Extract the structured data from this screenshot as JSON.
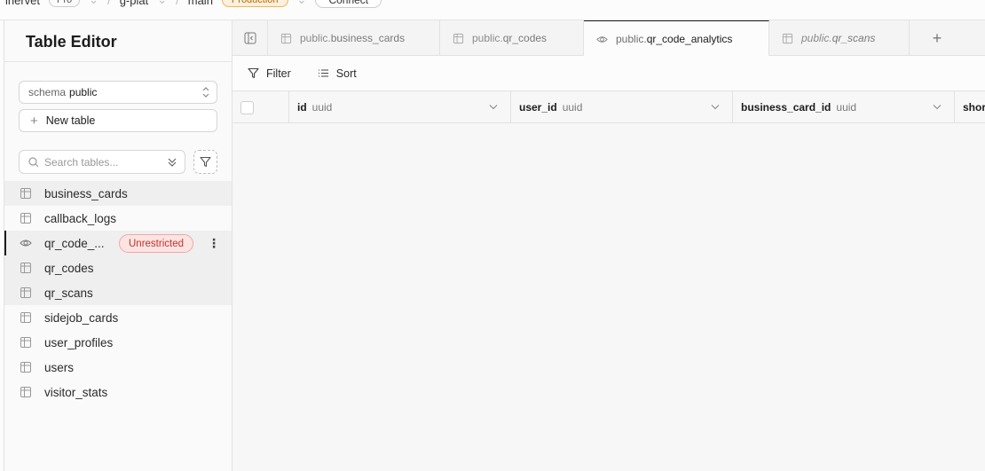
{
  "topbar": {
    "org": "inervet",
    "plan": "Pro",
    "project": "g-plat",
    "branch": "main",
    "env": "Production",
    "connect": "Connect"
  },
  "sidebar": {
    "title": "Table Editor",
    "schema_label": "schema",
    "schema_value": "public",
    "new_table": "New table",
    "search_placeholder": "Search tables...",
    "tables": [
      {
        "name": "business_cards",
        "icon": "table-icon"
      },
      {
        "name": "callback_logs",
        "icon": "table-icon"
      },
      {
        "name": "qr_code_...",
        "icon": "eye-icon",
        "badge": "Unrestricted"
      },
      {
        "name": "qr_codes",
        "icon": "table-icon"
      },
      {
        "name": "qr_scans",
        "icon": "table-icon"
      },
      {
        "name": "sidejob_cards",
        "icon": "table-icon"
      },
      {
        "name": "user_profiles",
        "icon": "table-icon"
      },
      {
        "name": "users",
        "icon": "table-icon"
      },
      {
        "name": "visitor_stats",
        "icon": "table-icon"
      }
    ]
  },
  "tabs": [
    {
      "schema": "public.",
      "name": "business_cards",
      "icon": "table-icon"
    },
    {
      "schema": "public.",
      "name": "qr_codes",
      "icon": "table-icon"
    },
    {
      "schema": "public.",
      "name": "qr_code_analytics",
      "icon": "eye-icon",
      "active": true
    },
    {
      "schema": "public.",
      "name": "qr_scans",
      "icon": "table-icon",
      "italic": true
    }
  ],
  "toolbar": {
    "filter": "Filter",
    "sort": "Sort"
  },
  "columns": [
    {
      "name": "id",
      "type": "uuid"
    },
    {
      "name": "user_id",
      "type": "uuid"
    },
    {
      "name": "business_card_id",
      "type": "uuid"
    },
    {
      "name": "shor",
      "type": ""
    }
  ]
}
